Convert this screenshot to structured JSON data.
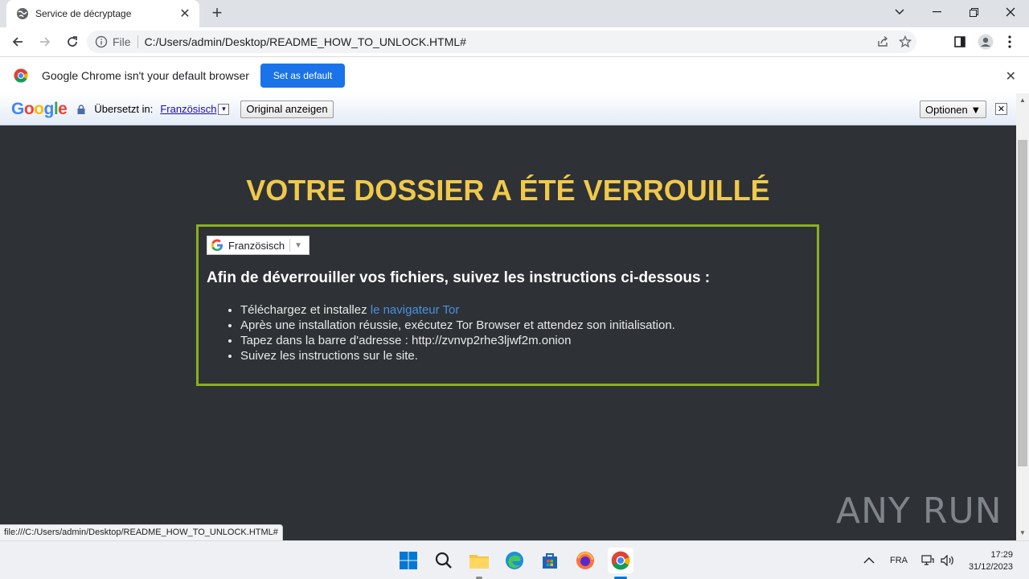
{
  "browser": {
    "tab_title": "Service de décryptage",
    "scheme_label": "File",
    "url": "C:/Users/admin/Desktop/README_HOW_TO_UNLOCK.HTML#"
  },
  "infobar": {
    "message": "Google Chrome isn't your default browser",
    "button": "Set as default"
  },
  "translate_bar": {
    "logo_text": "Google",
    "translated_to_label": "Übersetzt in:",
    "language": "Französisch",
    "show_original": "Original anzeigen",
    "options": "Optionen ▼"
  },
  "page": {
    "headline": "VOTRE DOSSIER A ÉTÉ VERROUILLÉ",
    "language_select": "Französisch",
    "instructions_heading": "Afin de déverrouiller vos fichiers, suivez les instructions ci-dessous :",
    "steps": [
      {
        "text": "Téléchargez et installez ",
        "link": "le navigateur Tor"
      },
      {
        "text": "Après une installation réussie, exécutez Tor Browser et attendez son initialisation."
      },
      {
        "text": "Tapez dans la barre d'adresse : http://zvnvp2rhe3ljwf2m.onion"
      },
      {
        "text": "Suivez les instructions sur le site."
      }
    ]
  },
  "status_bar": "file:///C:/Users/admin/Desktop/README_HOW_TO_UNLOCK.HTML#",
  "watermark": "ANY RUN",
  "taskbar": {
    "language": "FRA",
    "time": "17:29",
    "date": "31/12/2023"
  },
  "colors": {
    "page_bg": "#2e3236",
    "headline": "#f0c94a",
    "panel_border": "#8ab020",
    "link": "#4a90e2",
    "chrome_blue": "#1a73e8"
  }
}
